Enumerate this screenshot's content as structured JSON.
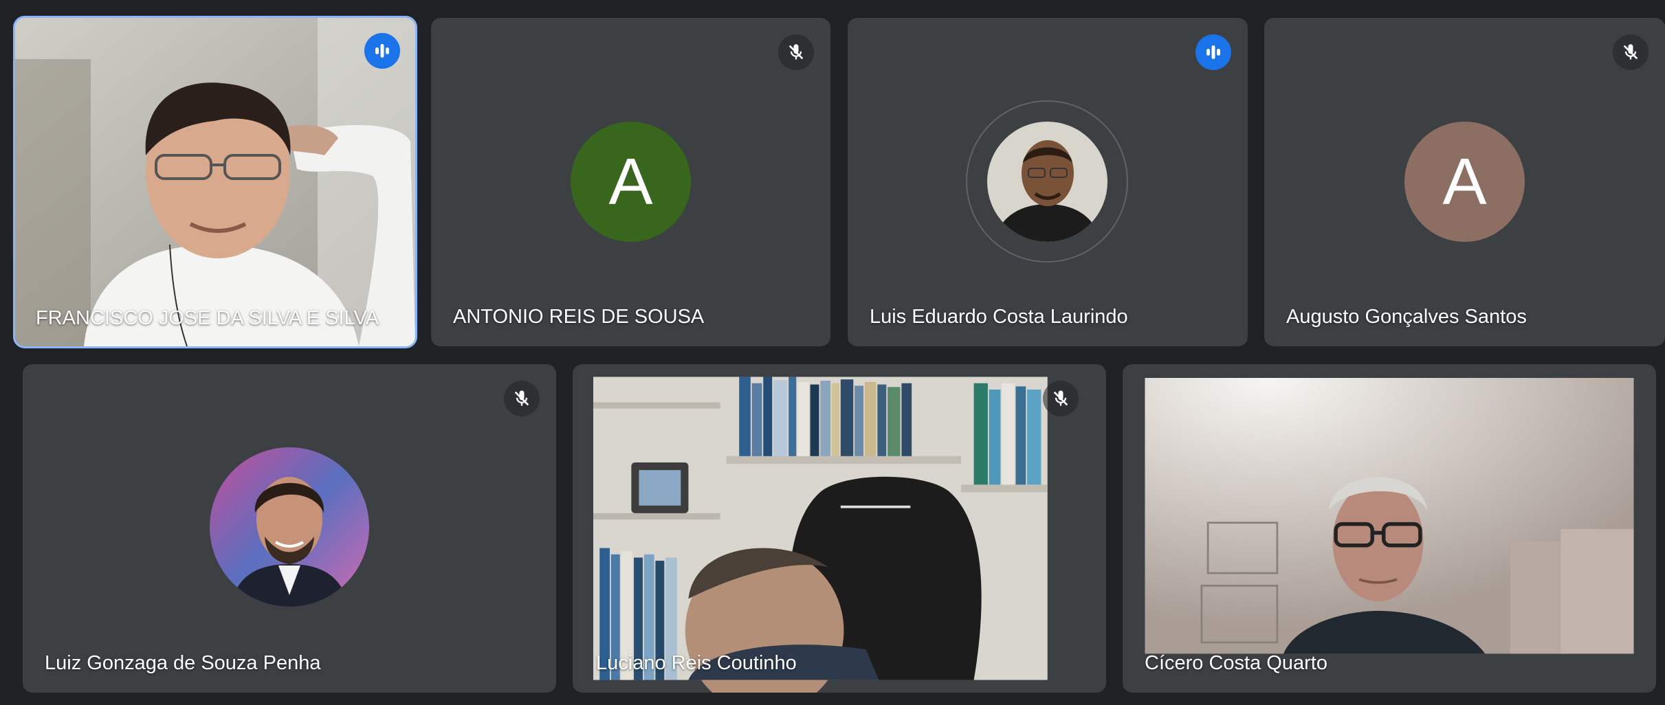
{
  "participants": [
    {
      "name": "FRANCISCO JOSE DA SILVA E SILVA",
      "mic": "speaking",
      "video": true,
      "active_speaker": true
    },
    {
      "name": "ANTONIO REIS DE SOUSA",
      "mic": "muted",
      "avatar_letter": "A",
      "avatar_color": "#38661c"
    },
    {
      "name": "Luis Eduardo Costa Laurindo",
      "mic": "speaking",
      "avatar_photo": true
    },
    {
      "name": "Augusto Gonçalves Santos",
      "mic": "muted",
      "avatar_letter": "A",
      "avatar_color": "#8d6e63"
    },
    {
      "name": "Luiz Gonzaga de Souza Penha",
      "mic": "muted",
      "avatar_photo": true
    },
    {
      "name": "Luciano Reis Coutinho",
      "mic": "muted",
      "video": true
    },
    {
      "name": "Cícero Costa Quarto",
      "mic": "none",
      "video": true
    }
  ],
  "colors": {
    "background": "#202124",
    "tile": "#3c4043",
    "active_border": "#8ab4f8",
    "speaking_badge": "#1a73e8"
  }
}
